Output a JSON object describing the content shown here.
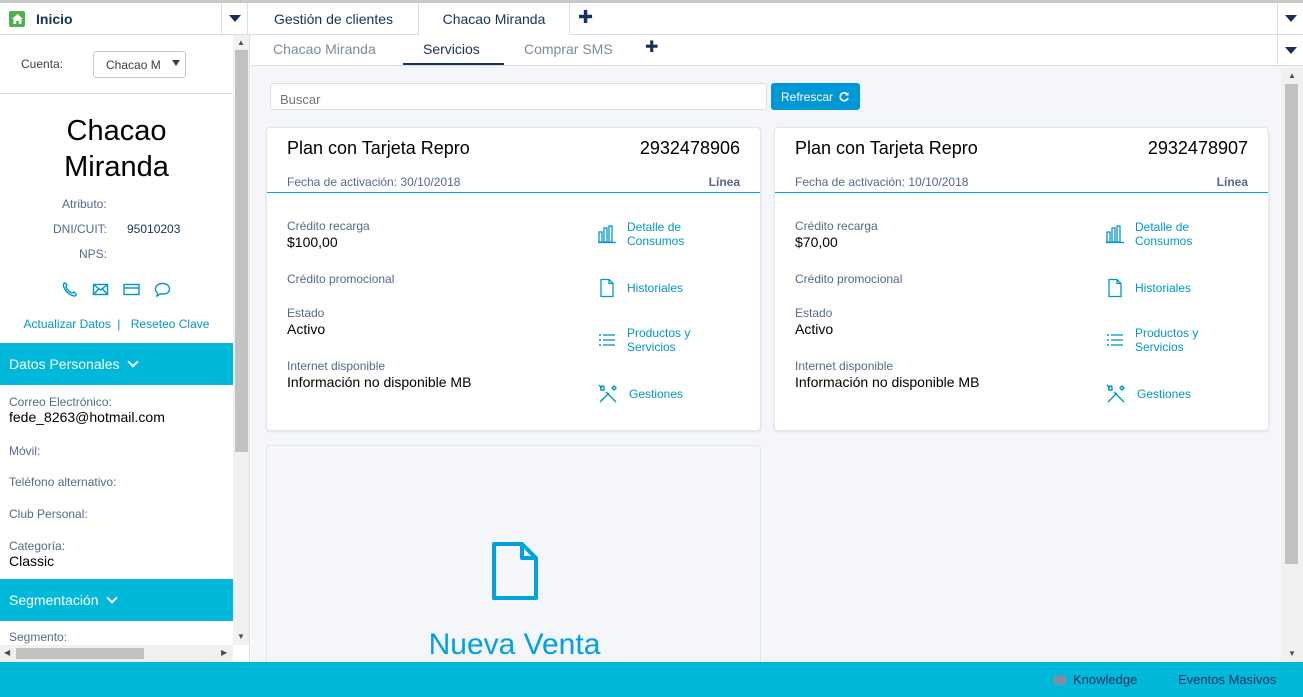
{
  "top_tabs": {
    "home_label": "Inicio",
    "tabs": [
      "Gestión de clientes",
      "Chacao Miranda"
    ]
  },
  "left": {
    "cuenta_label": "Cuenta:",
    "cuenta_value": "Chacao M",
    "account_name_line1": "Chacao",
    "account_name_line2": "Miranda",
    "atributo_label": "Atributo:",
    "dni_label": "DNI/CUIT:",
    "dni_value": "95010203",
    "nps_label": "NPS:",
    "link_actualizar": "Actualizar Datos",
    "link_sep": "|",
    "link_reseteo": "Reseteo Clave",
    "datos_personales": "Datos Personales",
    "correo_label": "Correo Electrónico:",
    "correo_value": "fede_8263@hotmail.com",
    "movil_label": "Móvil:",
    "tel_alt_label": "Teléfono alternativo:",
    "club_label": "Club Personal:",
    "categoria_label": "Categoría:",
    "categoria_value": "Classic",
    "segmentacion": "Segmentación",
    "segmento_label": "Segmento:"
  },
  "subtabs": [
    "Chacao Miranda",
    "Servicios",
    "Comprar SMS"
  ],
  "search_placeholder": "Buscar",
  "refresh_label": "Refrescar",
  "cards": [
    {
      "title": "Plan con Tarjeta Repro",
      "number": "2932478906",
      "fecha": "Fecha de activación: 30/10/2018",
      "tipo": "Línea",
      "credito_recarga_label": "Crédito recarga",
      "credito_recarga_value": "$100,00",
      "credito_promo_label": "Crédito promocional",
      "estado_label": "Estado",
      "estado_value": "Activo",
      "internet_label": "Internet disponible",
      "internet_value": "Información no disponible MB"
    },
    {
      "title": "Plan con Tarjeta Repro",
      "number": "2932478907",
      "fecha": "Fecha de activación: 10/10/2018",
      "tipo": "Línea",
      "credito_recarga_label": "Crédito recarga",
      "credito_recarga_value": "$70,00",
      "credito_promo_label": "Crédito promocional",
      "estado_label": "Estado",
      "estado_value": "Activo",
      "internet_label": "Internet disponible",
      "internet_value": "Información no disponible MB"
    }
  ],
  "actions": {
    "detalle_1": "Detalle de",
    "detalle_2": "Consumos",
    "historiales": "Historiales",
    "productos_1": "Productos y",
    "productos_2": "Servicios",
    "gestiones": "Gestiones"
  },
  "nueva_venta": "Nueva Venta",
  "footer": {
    "knowledge": "Knowledge",
    "eventos": "Eventos Masivos"
  },
  "colors": {
    "accent": "#00b8d9",
    "link": "#0097c6",
    "button": "#0097d6",
    "home_icon": "#4bb34b"
  }
}
